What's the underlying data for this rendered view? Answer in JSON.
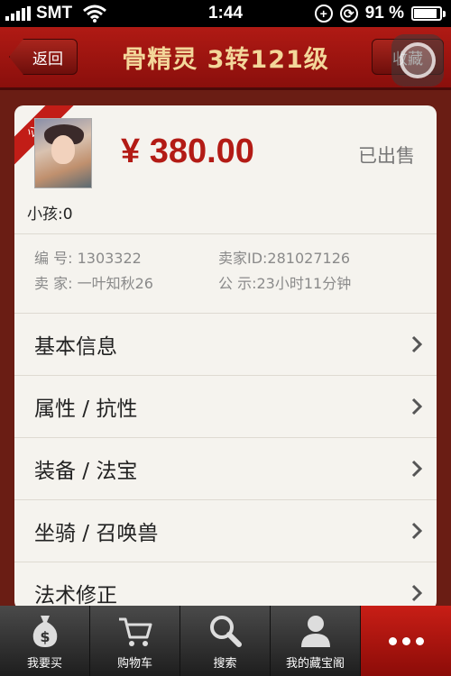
{
  "status_bar": {
    "carrier": "SMT",
    "time": "1:44",
    "battery": "91 %",
    "battery_level": 0.91
  },
  "nav": {
    "back_label": "返回",
    "title": "骨精灵 3转121级",
    "favorite_label": "收藏"
  },
  "item": {
    "ribbon": "公示",
    "price": "¥ 380.00",
    "status": "已出售",
    "children": "小孩:0",
    "info": {
      "id_label": "编  号:",
      "id_value": "1303322",
      "seller_id": "卖家ID:281027126",
      "seller_label": "卖  家:",
      "seller_value": "一叶知秋26",
      "notice_label": "公  示:",
      "notice_value": "23小时11分钟"
    }
  },
  "menu": [
    {
      "label": "基本信息"
    },
    {
      "label": "属性 / 抗性"
    },
    {
      "label": "装备 / 法宝"
    },
    {
      "label": "坐骑 / 召唤兽"
    },
    {
      "label": "法术修正"
    }
  ],
  "tabs": [
    {
      "label": "我要买",
      "icon": "money-bag-icon"
    },
    {
      "label": "购物车",
      "icon": "cart-icon"
    },
    {
      "label": "搜索",
      "icon": "search-icon"
    },
    {
      "label": "我的藏宝阁",
      "icon": "user-icon"
    },
    {
      "label": "",
      "icon": "more-icon"
    }
  ],
  "colors": {
    "accent": "#b31b15",
    "nav_title": "#f3d79a",
    "tab_active": "#c81e16"
  }
}
